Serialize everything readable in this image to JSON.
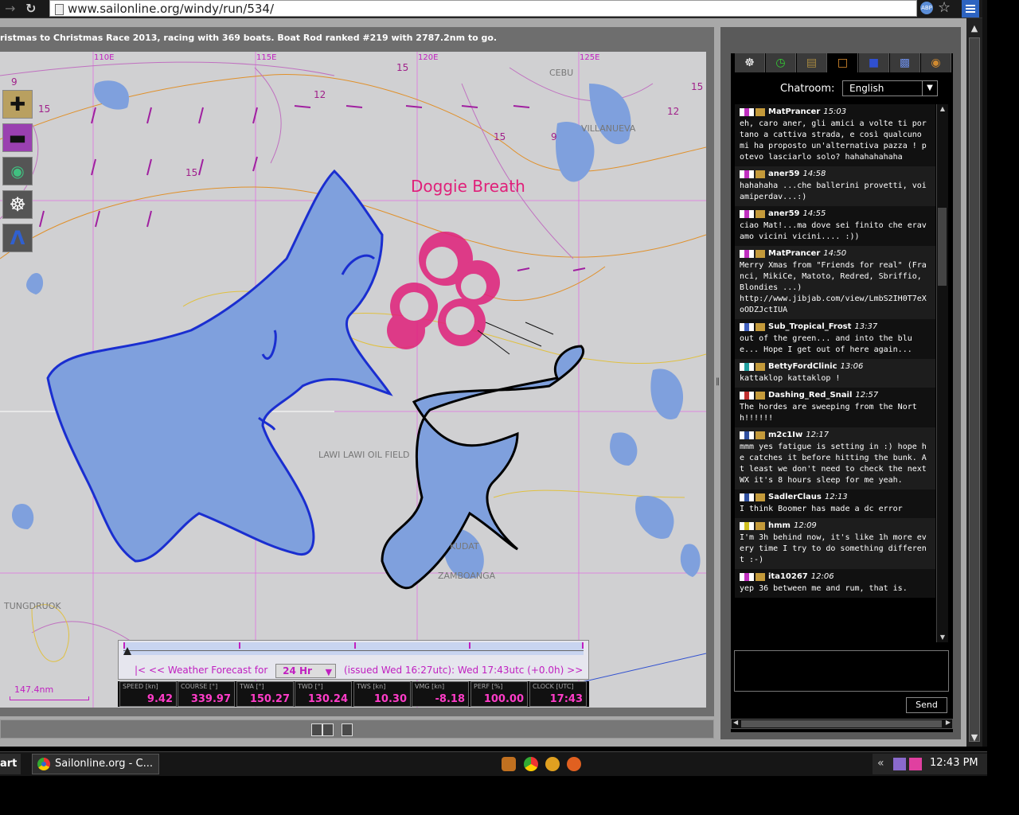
{
  "browser": {
    "url": "www.sailonline.org/windy/run/534/"
  },
  "race": {
    "status": "ristmas to Christmas Race 2013, racing with 369 boats. Boat Rod ranked #219 with 2787.2nm to go."
  },
  "map": {
    "longitudes": [
      "110E",
      "115E",
      "120E",
      "125E"
    ],
    "places": [
      "CEBU",
      "VILLANUEVA",
      "LAWI LAWI OIL FIELD",
      "ZAMBOANGA",
      "KUDAT",
      "TUNGDRUOK"
    ],
    "wind_speeds": [
      "9",
      "15",
      "12",
      "15",
      "15",
      "9",
      "15",
      "12",
      "15"
    ],
    "drawing_label": "Doggie Breath",
    "scale": "147.4nm",
    "tools": [
      {
        "name": "zoom-in",
        "icon": "plus-icon"
      },
      {
        "name": "zoom-out",
        "icon": "minus-icon"
      },
      {
        "name": "center-boat",
        "icon": "compass-icon"
      },
      {
        "name": "helm",
        "icon": "helm-icon"
      },
      {
        "name": "measure",
        "icon": "divider-icon"
      }
    ]
  },
  "weather": {
    "first": "|<",
    "prev": "<<",
    "label": "Weather Forecast for",
    "selected": "24 Hr",
    "issued": "(issued Wed 16:27utc): Wed 17:43utc  (+0.0h)",
    "next": ">>"
  },
  "instruments": [
    {
      "label": "SPEED [kn]",
      "value": "9.42"
    },
    {
      "label": "COURSE [°]",
      "value": "339.97"
    },
    {
      "label": "TWA [°]",
      "value": "150.27"
    },
    {
      "label": "TWD [°]",
      "value": "130.24"
    },
    {
      "label": "TWS [kn]",
      "value": "10.30"
    },
    {
      "label": "VMG [kn]",
      "value": "-8.18"
    },
    {
      "label": "PERF [%]",
      "value": "100.00"
    },
    {
      "label": "CLOCK [UTC]",
      "value": "17:43"
    }
  ],
  "tabs": [
    {
      "name": "helm-tab",
      "icon": "helm-icon"
    },
    {
      "name": "clock-tab",
      "icon": "clock-icon"
    },
    {
      "name": "leaderboard-tab",
      "icon": "ranking-icon"
    },
    {
      "name": "chat-tab",
      "icon": "chat-icon"
    },
    {
      "name": "book-tab",
      "icon": "book-icon"
    },
    {
      "name": "flags-tab",
      "icon": "flag-icon"
    },
    {
      "name": "settings-tab",
      "icon": "lifebuoy-icon"
    }
  ],
  "chat": {
    "label": "Chatroom:",
    "language": "English",
    "send": "Send",
    "messages": [
      {
        "user": "MatPrancer",
        "time": "15:03",
        "text": "eh, caro aner, gli amici a volte ti portano a cattiva strada, e così qualcuno mi ha proposto un'alternativa pazza ! potevo lasciarlo solo? hahahahahaha",
        "flag": "#c030c0"
      },
      {
        "user": "aner59",
        "time": "14:58",
        "text": "hahahaha ...che ballerini provetti, voi amiperdav...:)",
        "flag": "#c030c0"
      },
      {
        "user": "aner59",
        "time": "14:55",
        "text": "ciao Mat!...ma dove sei finito che eravamo vicini vicini.... :))",
        "flag": "#c030c0"
      },
      {
        "user": "MatPrancer",
        "time": "14:50",
        "text": "Merry Xmas from \"Friends for real\" (Franci, MikiCe, Matoto, Redred, Sbriffio, Blondies ...)\nhttp://www.jibjab.com/view/LmbS2IH0T7eXoODZJctIUA",
        "flag": "#c030c0"
      },
      {
        "user": "Sub_Tropical_Frost",
        "time": "13:37",
        "text": "out of the green... and into the blue... Hope I get out of here again...",
        "flag": "#4060c0"
      },
      {
        "user": "BettyFordClinic",
        "time": "13:06",
        "text": "kattaklop kattaklop !",
        "flag": "#20a0a0"
      },
      {
        "user": "Dashing_Red_Snail",
        "time": "12:57",
        "text": "The hordes are sweeping from the North!!!!!!",
        "flag": "#c03030"
      },
      {
        "user": "m2c1Iw",
        "time": "12:17",
        "text": "mmm yes fatigue is setting in :) hope he catches it before hitting the bunk. At least we don't need to check the next WX it's 8 hours sleep for me yeah.",
        "flag": "#3050a0"
      },
      {
        "user": "SadlerClaus",
        "time": "12:13",
        "text": "I think Boomer has made a dc error",
        "flag": "#3050a0"
      },
      {
        "user": "hmm",
        "time": "12:09",
        "text": "I'm 3h behind now, it's like 1h more every time I try to do something different :-)",
        "flag": "#d0c020"
      },
      {
        "user": "ita10267",
        "time": "12:06",
        "text": "yep 36 between me and rum, that is.",
        "flag": "#c030c0"
      }
    ]
  },
  "taskbar": {
    "start": "art",
    "task": "Sailonline.org - C...",
    "clock": "12:43 PM"
  }
}
